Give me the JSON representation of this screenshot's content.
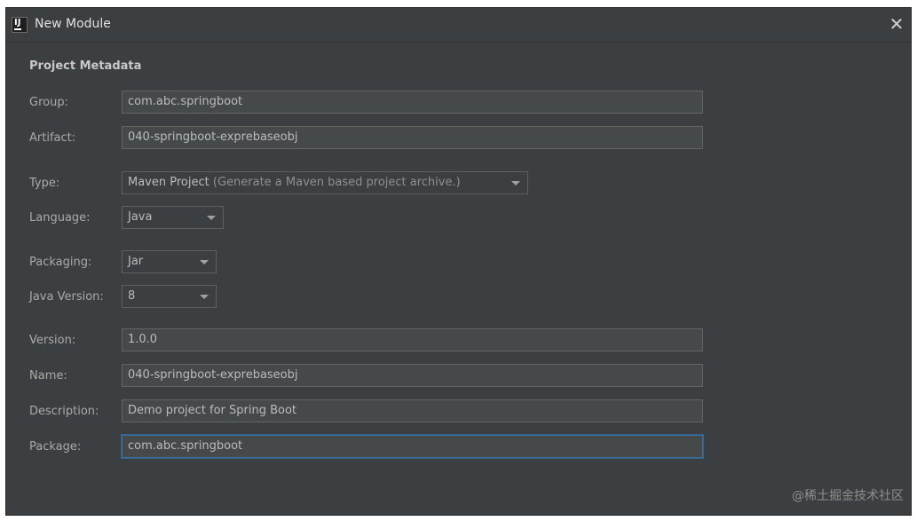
{
  "window": {
    "title": "New Module",
    "close_glyph": "✕"
  },
  "section": {
    "title": "Project Metadata"
  },
  "fields": {
    "group": {
      "label": "Group:",
      "value": "com.abc.springboot"
    },
    "artifact": {
      "label": "Artifact:",
      "value": "040-springboot-exprebaseobj"
    },
    "type": {
      "label": "Type:",
      "value": "Maven Project",
      "hint": "(Generate a Maven based project archive.)"
    },
    "language": {
      "label": "Language:",
      "value": "Java"
    },
    "packaging": {
      "label": "Packaging:",
      "value": "Jar"
    },
    "java_version": {
      "label": "Java Version:",
      "value": "8"
    },
    "version": {
      "label": "Version:",
      "value": "1.0.0"
    },
    "name": {
      "label": "Name:",
      "value": "040-springboot-exprebaseobj"
    },
    "description": {
      "label": "Description:",
      "value": "Demo project for Spring Boot"
    },
    "package": {
      "label": "Package:",
      "value": "com.abc.springboot"
    }
  },
  "icons": {
    "app": "intellij-app-icon",
    "close": "close-icon",
    "dropdown": "chevron-down-icon"
  },
  "colors": {
    "background": "#3c3f41",
    "field_background": "#45494a",
    "focus_border": "#3d6f9e"
  },
  "watermark": "@稀土掘金技术社区"
}
